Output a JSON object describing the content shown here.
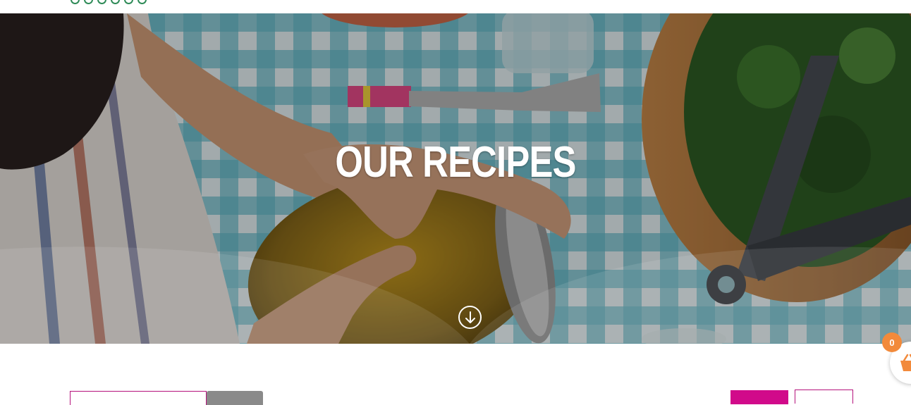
{
  "hero": {
    "title": "OUR RECIPES",
    "scroll_icon": "arrow-down-circle-icon"
  },
  "cart": {
    "count": "0",
    "icon": "shopping-basket-icon",
    "badge_color": "#f28a3b"
  },
  "colors": {
    "accent": "#d10a8a",
    "logo": "#2e8b57"
  }
}
